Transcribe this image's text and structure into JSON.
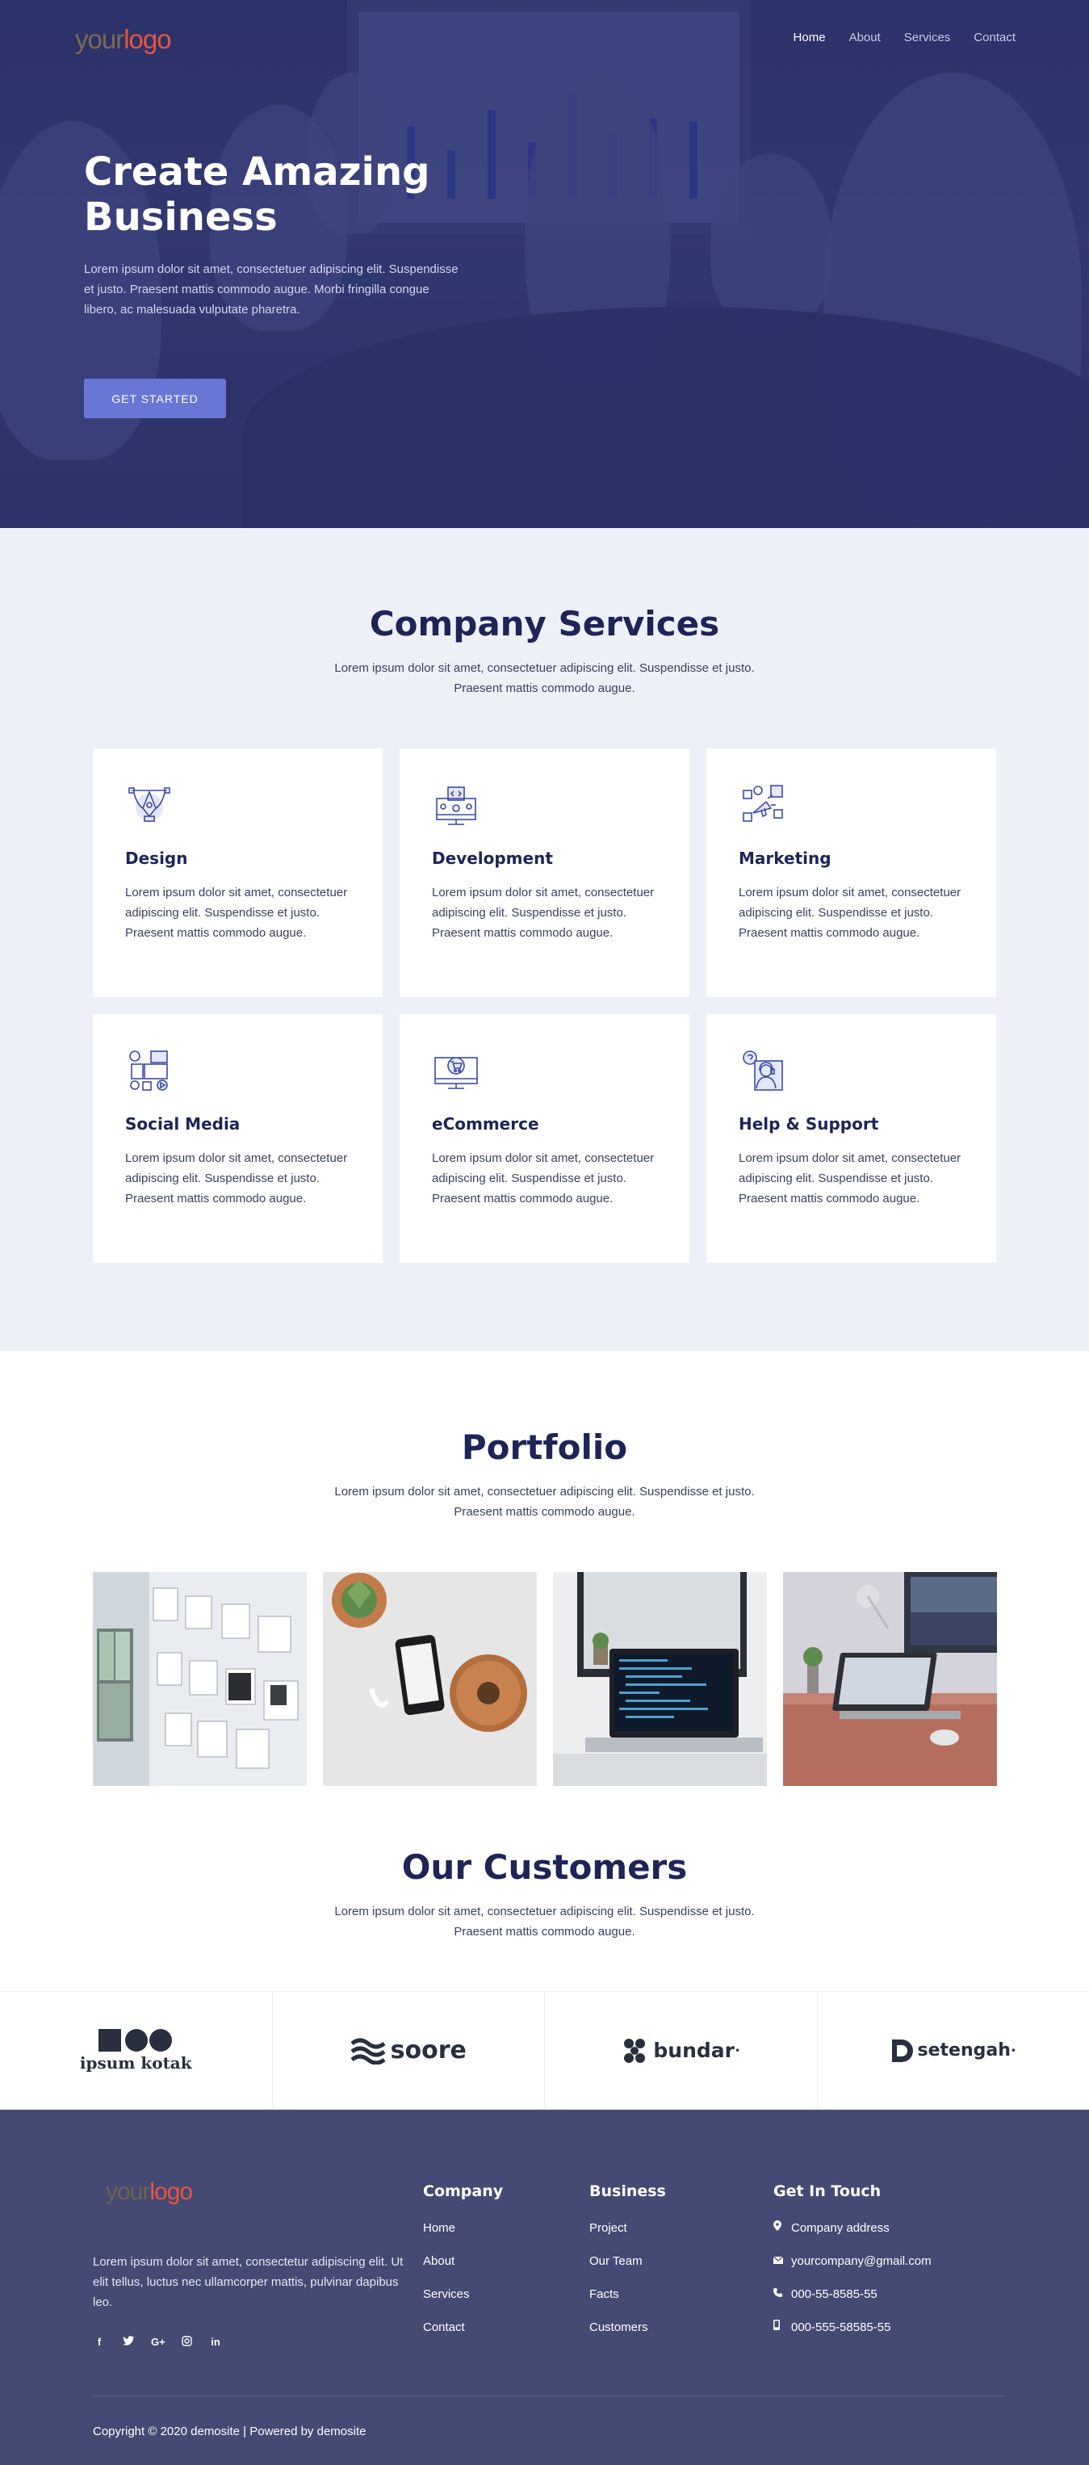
{
  "brand": {
    "logo_part1": "your",
    "logo_part2": "logo"
  },
  "nav": {
    "items": [
      "Home",
      "About",
      "Services",
      "Contact"
    ]
  },
  "hero": {
    "title": "Create Amazing Business",
    "text": "Lorem ipsum dolor sit amet, consectetuer adipiscing elit. Suspendisse et justo. Praesent mattis commodo augue. Morbi fringilla congue libero, ac malesuada vulputate pharetra.",
    "button": "GET STARTED"
  },
  "services": {
    "title": "Company Services",
    "subtitle": "Lorem ipsum dolor sit amet, consectetuer adipiscing elit. Suspendisse et justo. Praesent mattis commodo augue.",
    "cards": [
      {
        "icon": "design-icon",
        "title": "Design",
        "text": "Lorem ipsum dolor sit amet, consectetuer adipiscing elit. Suspendisse et justo. Praesent mattis commodo augue."
      },
      {
        "icon": "development-icon",
        "title": "Development",
        "text": "Lorem ipsum dolor sit amet, consectetuer adipiscing elit. Suspendisse et justo. Praesent mattis commodo augue."
      },
      {
        "icon": "marketing-icon",
        "title": "Marketing",
        "text": "Lorem ipsum dolor sit amet, consectetuer adipiscing elit. Suspendisse et justo. Praesent mattis commodo augue."
      },
      {
        "icon": "social-media-icon",
        "title": "Social Media",
        "text": "Lorem ipsum dolor sit amet, consectetuer adipiscing elit. Suspendisse et justo. Praesent mattis commodo augue."
      },
      {
        "icon": "ecommerce-icon",
        "title": "eCommerce",
        "text": "Lorem ipsum dolor sit amet, consectetuer adipiscing elit. Suspendisse et justo. Praesent mattis commodo augue."
      },
      {
        "icon": "help-support-icon",
        "title": "Help & Support",
        "text": "Lorem ipsum dolor sit amet, consectetuer adipiscing elit. Suspendisse et justo. Praesent mattis commodo augue."
      }
    ]
  },
  "portfolio": {
    "title": "Portfolio",
    "subtitle": "Lorem ipsum dolor sit amet, consectetuer adipiscing elit. Suspendisse et justo. Praesent mattis commodo augue."
  },
  "customers": {
    "title": "Our Customers",
    "subtitle": "Lorem ipsum dolor sit amet, consectetuer adipiscing elit. Suspendisse et justo. Praesent mattis commodo augue.",
    "logos": [
      "ipsum kotak",
      "soore",
      "bundar",
      "setengah"
    ]
  },
  "footer": {
    "about": "Lorem ipsum dolor sit amet, consectetur adipiscing elit. Ut elit tellus, luctus nec ullamcorper mattis, pulvinar dapibus leo.",
    "company": {
      "heading": "Company",
      "links": [
        "Home",
        "About",
        "Services",
        "Contact"
      ]
    },
    "business": {
      "heading": "Business",
      "links": [
        "Project",
        "Our Team",
        "Facts",
        "Customers"
      ]
    },
    "contact": {
      "heading": "Get In Touch",
      "address": "Company address",
      "email": "yourcompany@gmail.com",
      "phone": "000-55-8585-55",
      "mobile": "000-555-58585-55"
    },
    "social": [
      "f",
      "t",
      "G+",
      "ig",
      "in"
    ],
    "copyright": "Copyright © 2020 demosite | Powered by demosite"
  }
}
